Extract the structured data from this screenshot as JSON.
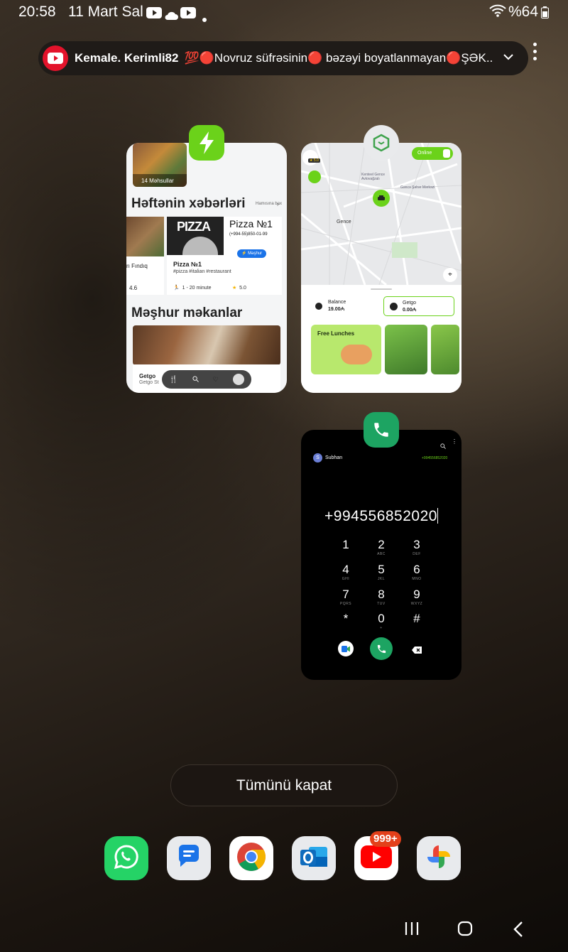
{
  "status_bar": {
    "time": "20:58",
    "date": "11 Mart Sal",
    "battery": "%64"
  },
  "notification": {
    "channel": "Kemale. Kerimli82",
    "message": "💯🔴Novruz süfrəsinin🔴 bəzəyi boyatlanmayan🔴ŞƏK..."
  },
  "app1": {
    "thumb_label": "14 Məhsullar",
    "section1_title": "Həftənin xəbərləri",
    "section1_link": "Hamısına bax",
    "left_card_name": "rı Fındıq",
    "left_card_rating": "4.6",
    "pizza_banner": "PIZZA",
    "pizza_title": "Pizza №1",
    "pizza_phone": "(+994-55)850-01-99",
    "badge": "Məşhur",
    "pizza_name": "Pizza №1",
    "pizza_tags": "#pizza #italian #restaurant",
    "pizza_time": "1 - 20 minute",
    "pizza_rating": "5.0",
    "section2_title": "Məşhur məkanlar",
    "place_name": "Getgo",
    "place_sub": "Getgo St"
  },
  "app2": {
    "online_label": "Online",
    "city_label": "Gence",
    "map_label_1": "Kenteel Gence Avtovağzalı",
    "map_label_2": "Gəncə Şəhər Mərkəzi",
    "balance_label": "Balance",
    "balance_value": "19.00₼",
    "getgo_label": "Getgo",
    "getgo_value": "0.00₼",
    "promo_title": "Free Lunches",
    "rating_badge": "★ 5.0"
  },
  "app3": {
    "contact": "Subhan",
    "contact_number": "+994556852020",
    "dial_input": "+994556852020",
    "keys": [
      {
        "n": "1",
        "l": ""
      },
      {
        "n": "2",
        "l": "ABC"
      },
      {
        "n": "3",
        "l": "DEF"
      },
      {
        "n": "4",
        "l": "GHI"
      },
      {
        "n": "5",
        "l": "JKL"
      },
      {
        "n": "6",
        "l": "MNO"
      },
      {
        "n": "7",
        "l": "PQRS"
      },
      {
        "n": "8",
        "l": "TUV"
      },
      {
        "n": "9",
        "l": "WXYZ"
      },
      {
        "n": "*",
        "l": ""
      },
      {
        "n": "0",
        "l": "+"
      },
      {
        "n": "#",
        "l": ""
      }
    ]
  },
  "close_all": "Tümünü kapat",
  "dock": [
    {
      "icon": "whatsapp-icon",
      "badge": ""
    },
    {
      "icon": "messages-icon",
      "badge": ""
    },
    {
      "icon": "chrome-icon",
      "badge": ""
    },
    {
      "icon": "outlook-icon",
      "badge": ""
    },
    {
      "icon": "youtube-icon",
      "badge": "999+"
    },
    {
      "icon": "photos-icon",
      "badge": ""
    }
  ],
  "colors": {
    "accent_green": "#6bd21a",
    "youtube_red": "#e3132b",
    "phone_green": "#1da462"
  }
}
